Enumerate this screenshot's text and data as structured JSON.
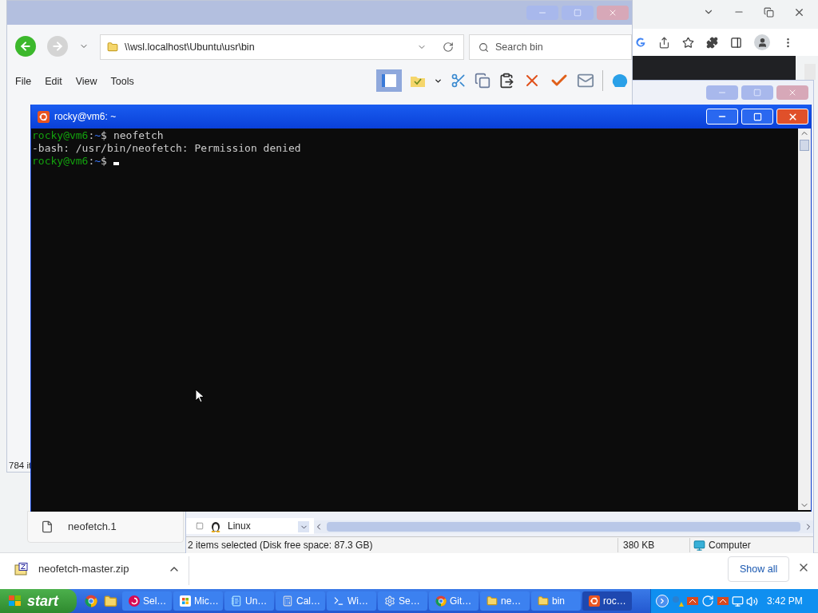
{
  "browser": {
    "download_file": "neofetch-master.zip",
    "show_all": "Show all"
  },
  "explorer": {
    "address": "\\\\wsl.localhost\\Ubuntu\\usr\\bin",
    "search": {
      "placeholder": "Search bin"
    },
    "menu": [
      "File",
      "Edit",
      "View",
      "Tools"
    ],
    "status": "784 it"
  },
  "explorer2": {
    "tree_item": "Linux",
    "status": "2 items selected (Disk free space: 87.3 GB)",
    "size": "380 KB",
    "zone": "Computer"
  },
  "file_item": "neofetch.1",
  "terminal": {
    "title": "rocky@vm6: ~",
    "lines": [
      {
        "kind": "prompt",
        "user": "rocky@vm6",
        "sep": ":",
        "path": "~",
        "dollar": "$",
        "command": "neofetch"
      },
      {
        "kind": "output",
        "text": "-bash: /usr/bin/neofetch: Permission denied"
      },
      {
        "kind": "prompt",
        "user": "rocky@vm6",
        "sep": ":",
        "path": "~",
        "dollar": "$",
        "cursor": true
      }
    ]
  },
  "taskbar": {
    "start": "start",
    "tasks": [
      {
        "label": "Sel…",
        "kind": "swirl",
        "selected": false
      },
      {
        "label": "Mic…",
        "kind": "store",
        "selected": false
      },
      {
        "label": "Un…",
        "kind": "notepad",
        "selected": false
      },
      {
        "label": "Cal…",
        "kind": "calculator",
        "selected": false
      },
      {
        "label": "Wi…",
        "kind": "terminal",
        "selected": false
      },
      {
        "label": "Se…",
        "kind": "gear",
        "selected": false
      },
      {
        "label": "Git…",
        "kind": "chrome",
        "selected": false
      },
      {
        "label": "ne…",
        "kind": "folder",
        "selected": false
      },
      {
        "label": "bin",
        "kind": "folder",
        "selected": false
      },
      {
        "label": "roc…",
        "kind": "ubuntu",
        "selected": true
      }
    ],
    "clock": "3:42 PM"
  }
}
